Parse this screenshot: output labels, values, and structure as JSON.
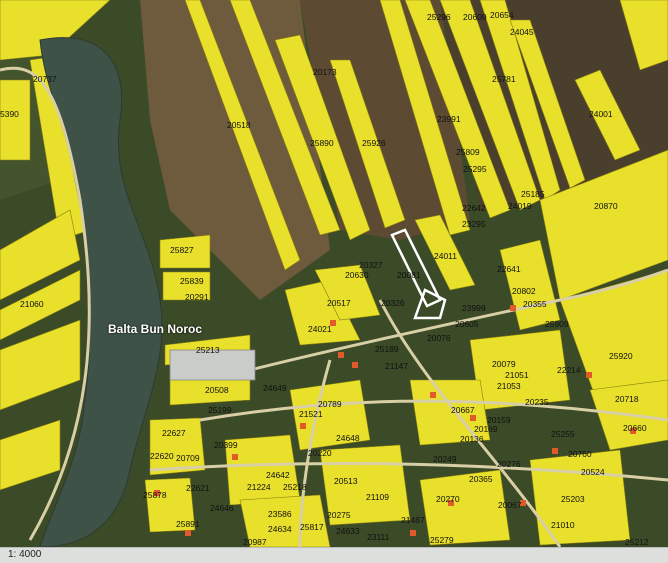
{
  "map": {
    "lake_name": "Balta Bun Noroc",
    "scale": "1: 4000",
    "parcels": [
      "25296",
      "20609",
      "20654",
      "24045",
      "20737",
      "5390",
      "20173",
      "20518",
      "25781",
      "23991",
      "24001",
      "25890",
      "25926",
      "25809",
      "25295",
      "25185",
      "24019",
      "20870",
      "22642",
      "23295",
      "25827",
      "24011",
      "20327",
      "20630",
      "20081",
      "22641",
      "25839",
      "20802",
      "20291",
      "20517",
      "20326",
      "23999",
      "20355",
      "21060",
      "24021",
      "20605",
      "25909",
      "25213",
      "25189",
      "20076",
      "21147",
      "20079",
      "25920",
      "21051",
      "22214",
      "20508",
      "24649",
      "21053",
      "25199",
      "20789",
      "20667",
      "20235",
      "20718",
      "21521",
      "20159",
      "22627",
      "20399",
      "24648",
      "20169",
      "20136",
      "25255",
      "20660",
      "22620",
      "20709",
      "20220",
      "20249",
      "20276",
      "20760",
      "24642",
      "20524",
      "21224",
      "25218",
      "20513",
      "20365",
      "25878",
      "22621",
      "21109",
      "20270",
      "25203",
      "24646",
      "25891",
      "23586",
      "20275",
      "21487",
      "20067",
      "21010",
      "24634",
      "25817",
      "24633",
      "23111",
      "25279",
      "20987",
      "25212"
    ]
  }
}
